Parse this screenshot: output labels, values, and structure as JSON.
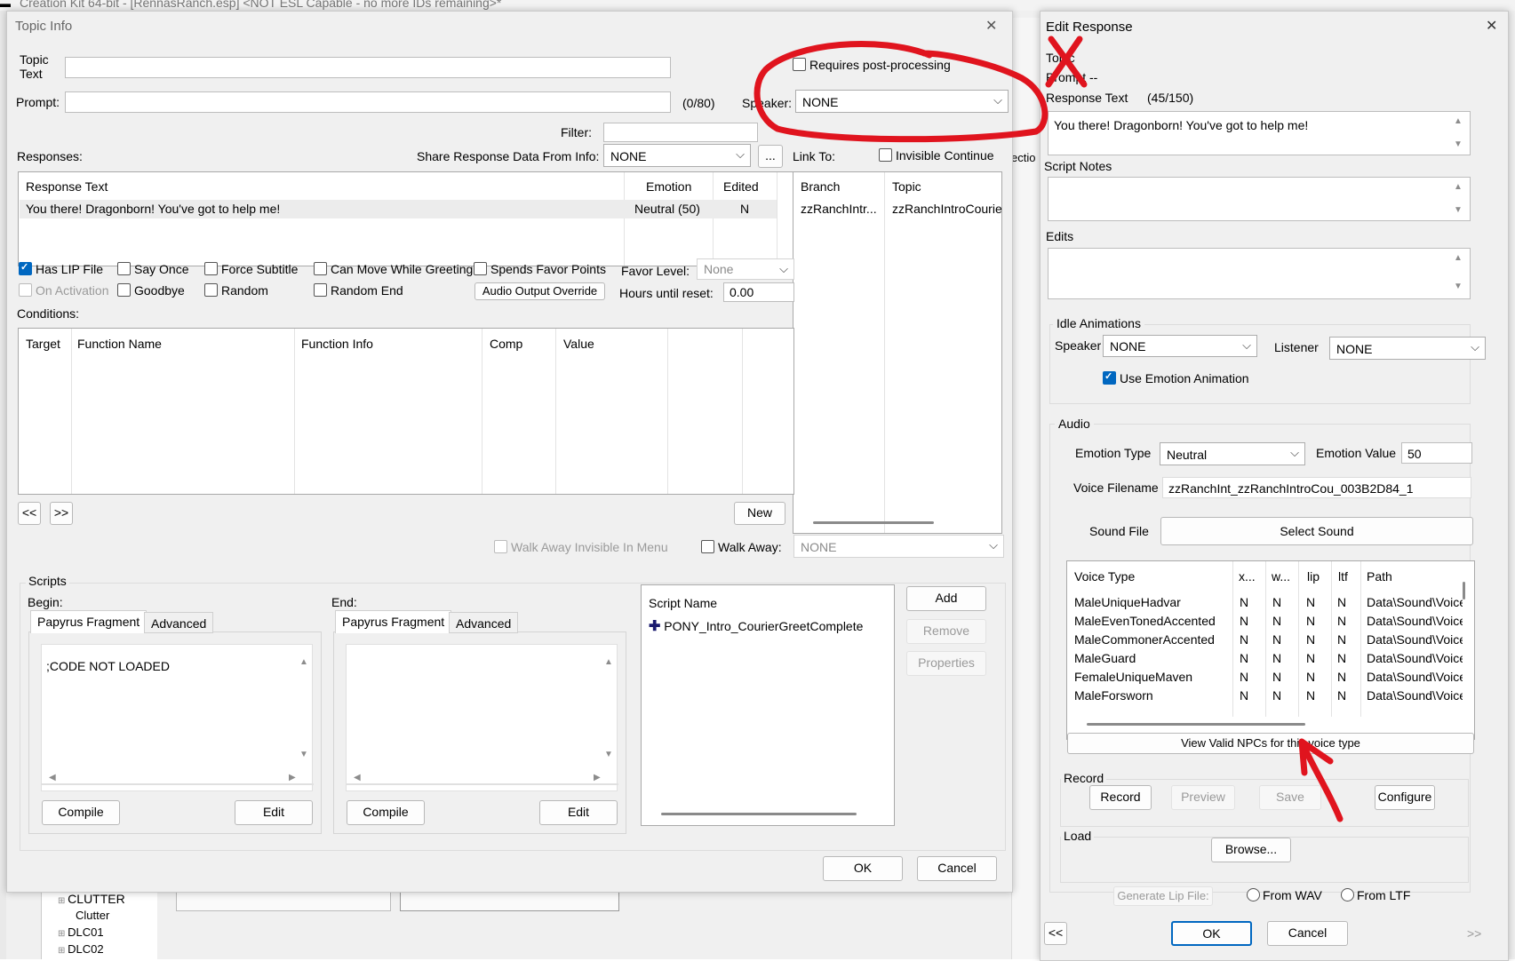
{
  "app_title": "Creation Kit 64-bit - [RennasRanch.esp] <NOT ESL Capable - no more IDs remaining>*",
  "topic": {
    "title": "Topic Info",
    "close_glyph": "✕",
    "topic_text_label": "Topic\nText",
    "topic_text_value": "",
    "prompt_label": "Prompt:",
    "prompt_value": "",
    "prompt_counter": "(0/80)",
    "requires_post": "Requires post-processing",
    "speaker_label": "Speaker:",
    "speaker_value": "NONE",
    "filter_label": "Filter:",
    "filter_value": "",
    "responses_label": "Responses:",
    "share_label": "Share Response Data From Info:",
    "share_value": "NONE",
    "ellipsis": "...",
    "link_to_label": "Link To:",
    "invisible_continue": "Invisible Continue",
    "responses_headers": [
      "Response Text",
      "Emotion",
      "Edited"
    ],
    "responses_rows": [
      [
        "You there! Dragonborn! You've got to help me!",
        "Neutral (50)",
        "N"
      ]
    ],
    "link_headers": [
      "Branch",
      "Topic"
    ],
    "link_rows": [
      [
        "zzRanchIntr...",
        "zzRanchIntroCourie"
      ]
    ],
    "checkboxes": {
      "has_lip": "Has LIP File",
      "say_once": "Say Once",
      "force_subtitle": "Force Subtitle",
      "can_move": "Can Move While Greeting",
      "spends_favor": "Spends Favor Points",
      "on_activation": "On Activation",
      "goodbye": "Goodbye",
      "random": "Random",
      "random_end": "Random End"
    },
    "favor_level_label": "Favor Level:",
    "favor_level_value": "None",
    "audio_override": "Audio Output Override",
    "hours_label": "Hours until reset:",
    "hours_value": "0.00",
    "conditions_label": "Conditions:",
    "conditions_headers": [
      "Target",
      "Function Name",
      "Function Info",
      "Comp",
      "Value"
    ],
    "prev": "<<",
    "next": ">>",
    "new_btn": "New",
    "walk_away_invisible": "Walk Away Invisible In Menu",
    "walk_away": "Walk Away:",
    "walk_away_value": "NONE",
    "scripts_label": "Scripts",
    "begin_label": "Begin:",
    "end_label": "End:",
    "tab_papyrus": "Papyrus Fragment",
    "tab_advanced": "Advanced",
    "begin_code": ";CODE NOT LOADED",
    "compile": "Compile",
    "edit": "Edit",
    "script_name_header": "Script Name",
    "script_item": "PONY_Intro_CourierGreetComplete",
    "add": "Add",
    "remove": "Remove",
    "properties": "Properties",
    "ok": "OK",
    "cancel": "Cancel"
  },
  "edit": {
    "title": "Edit Response",
    "close_glyph": "✕",
    "topic_label": "Topic",
    "prompt_label": "Prompt --",
    "response_text_label": "Response Text",
    "response_counter": "(45/150)",
    "response_text": "You there! Dragonborn! You've got to help me!",
    "script_notes_label": "Script Notes",
    "edits_label": "Edits",
    "idle_label": "Idle Animations",
    "speaker_label": "Speaker",
    "speaker_value": "NONE",
    "listener_label": "Listener",
    "listener_value": "NONE",
    "use_emotion": "Use Emotion Animation",
    "audio_label": "Audio",
    "emotion_type_label": "Emotion Type",
    "emotion_type_value": "Neutral",
    "emotion_value_label": "Emotion Value",
    "emotion_value": "50",
    "voice_filename_label": "Voice Filename",
    "voice_filename": "zzRanchInt_zzRanchIntroCou_003B2D84_1",
    "sound_file_label": "Sound File",
    "select_sound": "Select Sound",
    "voice_headers": [
      "Voice Type",
      "x...",
      "w...",
      "lip",
      "ltf",
      "Path"
    ],
    "voice_rows": [
      [
        "MaleUniqueHadvar",
        "N",
        "N",
        "N",
        "N",
        "Data\\Sound\\Voice"
      ],
      [
        "MaleEvenTonedAccented",
        "N",
        "N",
        "N",
        "N",
        "Data\\Sound\\Voice"
      ],
      [
        "MaleCommonerAccented",
        "N",
        "N",
        "N",
        "N",
        "Data\\Sound\\Voice"
      ],
      [
        "MaleGuard",
        "N",
        "N",
        "N",
        "N",
        "Data\\Sound\\Voice"
      ],
      [
        "FemaleUniqueMaven",
        "N",
        "N",
        "N",
        "N",
        "Data\\Sound\\Voice"
      ],
      [
        "MaleForsworn",
        "N",
        "N",
        "N",
        "N",
        "Data\\Sound\\Voice"
      ]
    ],
    "view_valid": "View Valid NPCs for this voice type",
    "record_label": "Record",
    "record": "Record",
    "preview": "Preview",
    "save": "Save",
    "configure": "Configure",
    "load_label": "Load",
    "browse": "Browse...",
    "generate_lip": "Generate Lip File:",
    "from_wav": "From WAV",
    "from_ltf": "From LTF",
    "prev": "<<",
    "next": ">>",
    "ok": "OK",
    "cancel": "Cancel"
  },
  "background": {
    "tree": [
      "CLUTTER",
      "Clutter",
      "DLC01",
      "DLC02"
    ],
    "partial_text": "ectio"
  },
  "annotation_color": "#e0141e"
}
